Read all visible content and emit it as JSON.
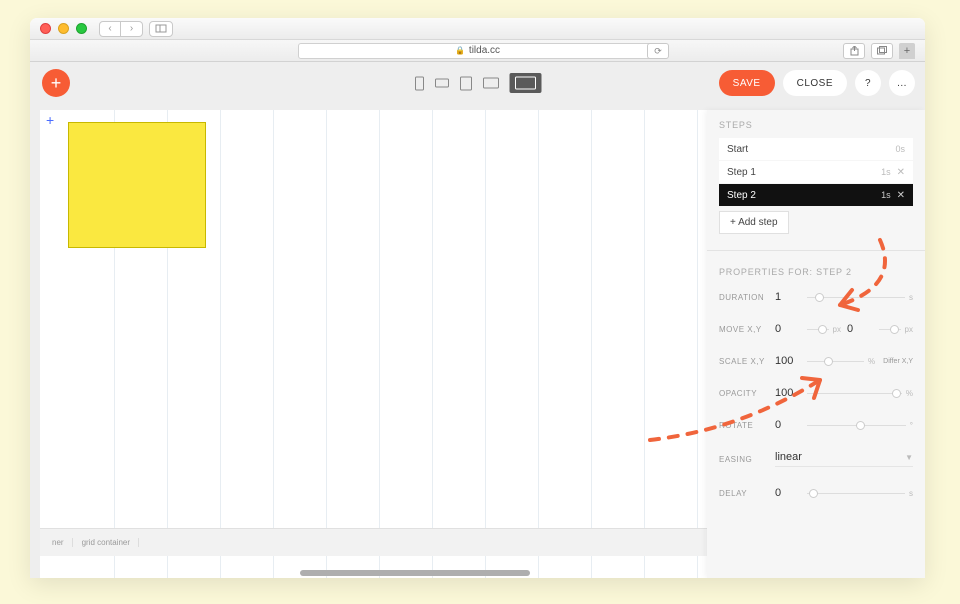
{
  "browser": {
    "url_host": "tilda.cc"
  },
  "toolbar": {
    "save_label": "SAVE",
    "close_label": "CLOSE",
    "help_label": "?",
    "more_label": "..."
  },
  "canvas": {
    "bottom_tags": [
      "ner",
      "grid container"
    ]
  },
  "panel": {
    "steps_heading": "STEPS",
    "steps": [
      {
        "label": "Start",
        "time": "0s",
        "closable": false,
        "active": false
      },
      {
        "label": "Step 1",
        "time": "1s",
        "closable": true,
        "active": false
      },
      {
        "label": "Step 2",
        "time": "1s",
        "closable": true,
        "active": true
      }
    ],
    "add_step_label": "+ Add step",
    "props_heading": "PROPERTIES FOR: STEP 2",
    "duration": {
      "label": "DURATION",
      "value": "1",
      "unit": "s"
    },
    "move": {
      "label": "MOVE X,Y",
      "x": "0",
      "y": "0",
      "unit": "px"
    },
    "scale": {
      "label": "SCALE X,Y",
      "value": "100",
      "unit": "%",
      "differ": "Differ X,Y"
    },
    "opacity": {
      "label": "OPACITY",
      "value": "100",
      "unit": "%"
    },
    "rotate": {
      "label": "ROTATE",
      "value": "0",
      "unit": "°"
    },
    "easing": {
      "label": "EASING",
      "value": "linear"
    },
    "delay": {
      "label": "DELAY",
      "value": "0",
      "unit": "s"
    }
  }
}
